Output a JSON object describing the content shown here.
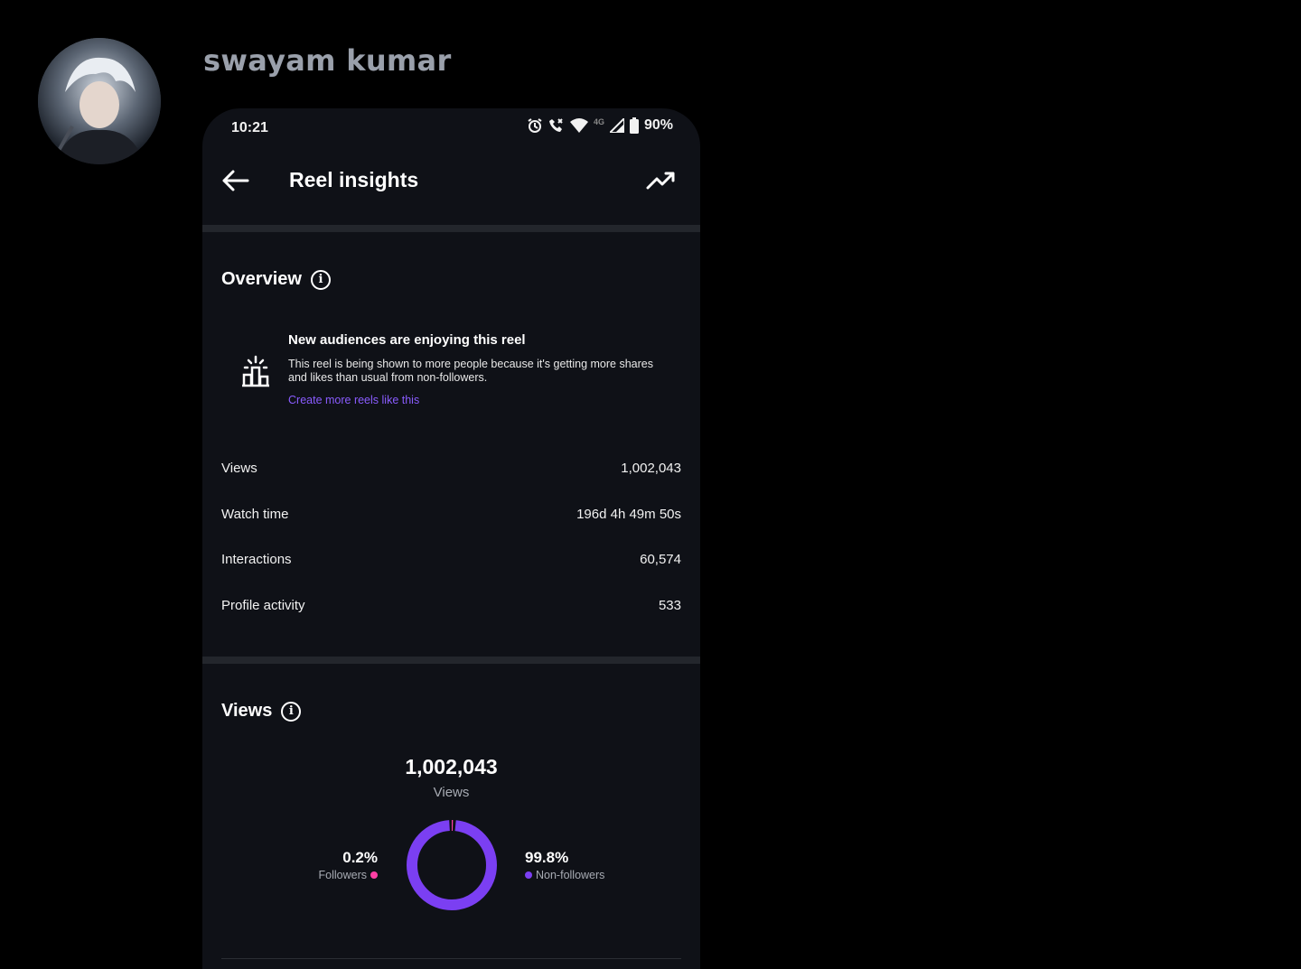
{
  "chat": {
    "sender_name": "swayam kumar"
  },
  "status_bar": {
    "time": "10:21",
    "network": "4G",
    "battery": "90%",
    "icons": [
      "alarm-icon",
      "call-icon",
      "wifi-icon",
      "signal-icon",
      "battery-icon"
    ]
  },
  "app_bar": {
    "title": "Reel insights",
    "back_icon": "arrow-left-icon",
    "trend_icon": "trending-up-icon"
  },
  "overview": {
    "title": "Overview",
    "info_icon": "i",
    "promo": {
      "icon": "podium-icon",
      "title": "New audiences are enjoying this reel",
      "text": "This reel is being shown to more people because it's getting more shares and likes than usual from non-followers.",
      "link": "Create more reels like this"
    },
    "metrics": [
      {
        "label": "Views",
        "value": "1,002,043"
      },
      {
        "label": "Watch time",
        "value": "196d 4h 49m 50s"
      },
      {
        "label": "Interactions",
        "value": "60,574"
      },
      {
        "label": "Profile activity",
        "value": "533"
      }
    ]
  },
  "views": {
    "title": "Views",
    "info_icon": "i",
    "total": "1,002,043",
    "total_label": "Views",
    "followers": {
      "pct": "0.2%",
      "label": "Followers",
      "color": "#ff3fa4",
      "fraction": 0.002
    },
    "non_followers": {
      "pct": "99.8%",
      "label": "Non-followers",
      "color": "#7b3ff2",
      "fraction": 0.998
    }
  }
}
